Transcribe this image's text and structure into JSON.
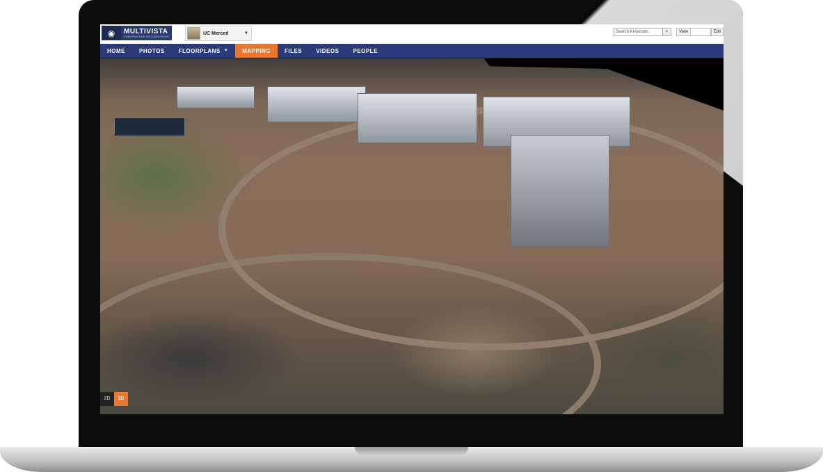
{
  "brand": {
    "name": "MULTIVISTA",
    "tagline": "CONSTRUCTION DOCUMENTATION"
  },
  "project": {
    "name": "UC Merced"
  },
  "search": {
    "placeholder": "Search Keywords"
  },
  "view_controls": {
    "view_label": "View",
    "edit_label": "Edit"
  },
  "nav": {
    "items": [
      {
        "label": "HOME"
      },
      {
        "label": "PHOTOS"
      },
      {
        "label": "FLOORPLANS"
      },
      {
        "label": "MAPPING"
      },
      {
        "label": "FILES"
      },
      {
        "label": "VIDEOS"
      },
      {
        "label": "PEOPLE"
      }
    ],
    "active": "MAPPING"
  },
  "map_mode": {
    "options": [
      "2D",
      "3D"
    ],
    "selected": "3D"
  },
  "colors": {
    "nav_bg": "#2b3a78",
    "accent": "#e8782f"
  }
}
